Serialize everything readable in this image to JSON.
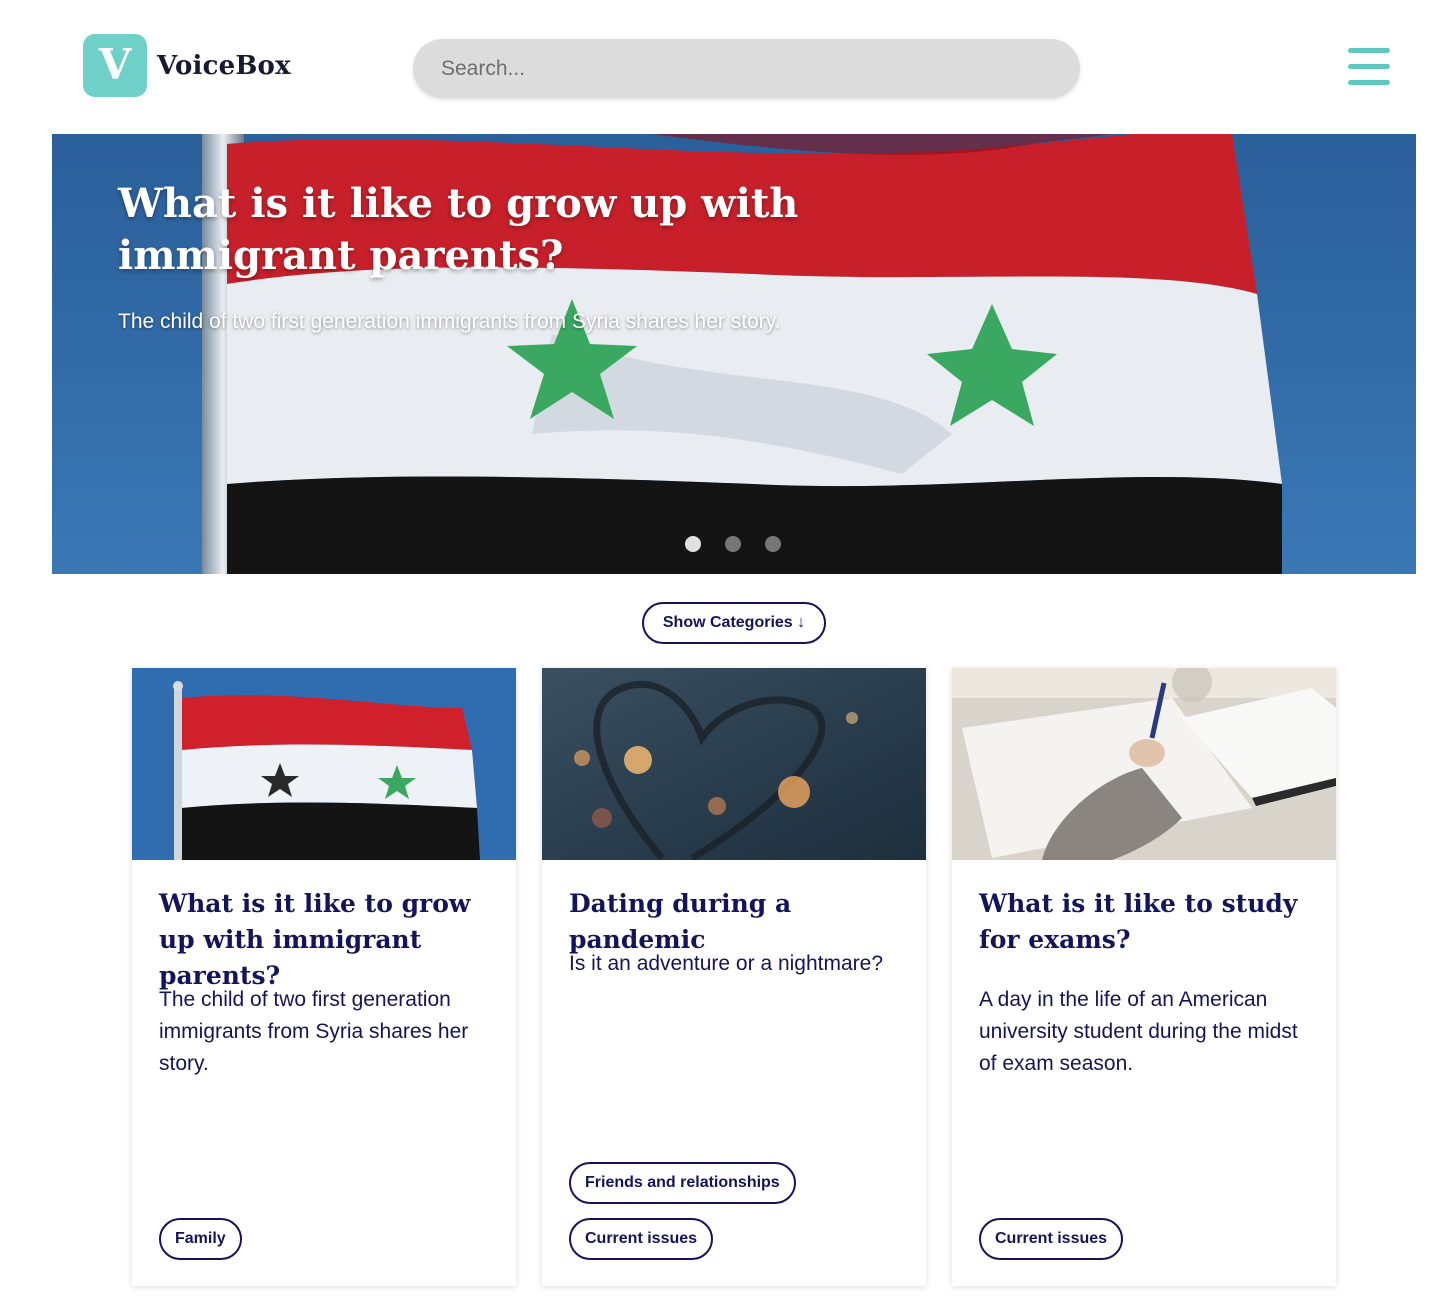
{
  "header": {
    "logo_letter": "V",
    "logo_text": "VoiceBox",
    "search_placeholder": "Search..."
  },
  "hero": {
    "title": "What is it like to grow up with immigrant parents?",
    "subtitle": "The child of two first generation immigrants from Syria shares her story.",
    "slides": 3,
    "active_slide": 1
  },
  "categories_button": "Show Categories ↓",
  "cards": [
    {
      "title": "What is it like to grow up with immigrant parents?",
      "description": "The child of two first generation immigrants from Syria shares her story.",
      "tags": [
        "Family"
      ]
    },
    {
      "title": "Dating during a pandemic",
      "description": "Is it an adventure or a nightmare?",
      "tags": [
        "Friends and relationships",
        "Current issues"
      ]
    },
    {
      "title": "What is it like to study for exams?",
      "description": "A day in the life of an American university student during the midst of exam season.",
      "tags": [
        "Current issues"
      ]
    }
  ],
  "colors": {
    "brand_teal": "#6fcfc9",
    "navy_text": "#14145a",
    "search_bg": "#dcdcdc"
  }
}
